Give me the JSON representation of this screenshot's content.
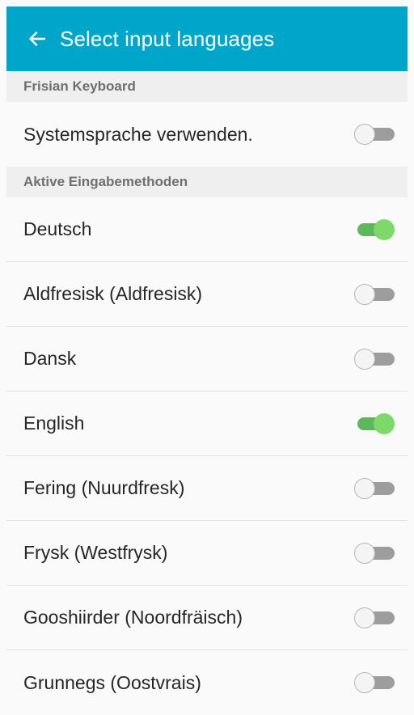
{
  "header": {
    "title": "Select input languages",
    "back_icon": "arrow-left-icon",
    "background_color": "#00a6c9"
  },
  "sections": [
    {
      "title": "Frisian Keyboard",
      "items": [
        {
          "label": "Systemsprache verwenden.",
          "enabled": false
        }
      ]
    },
    {
      "title": "Aktive Eingabemethoden",
      "items": [
        {
          "label": "Deutsch",
          "enabled": true
        },
        {
          "label": "Aldfresisk (Aldfresisk)",
          "enabled": false
        },
        {
          "label": "Dansk",
          "enabled": false
        },
        {
          "label": "English",
          "enabled": true
        },
        {
          "label": "Fering (Nuurdfresk)",
          "enabled": false
        },
        {
          "label": "Frysk (Westfrysk)",
          "enabled": false
        },
        {
          "label": "Gooshiirder (Noordfräisch)",
          "enabled": false
        },
        {
          "label": "Grunnegs (Oostvrais)",
          "enabled": false
        }
      ]
    }
  ],
  "colors": {
    "toggle_on_track": "#5cb85c",
    "toggle_on_thumb": "#7fd96a",
    "toggle_off_track": "#9d9d9d"
  }
}
